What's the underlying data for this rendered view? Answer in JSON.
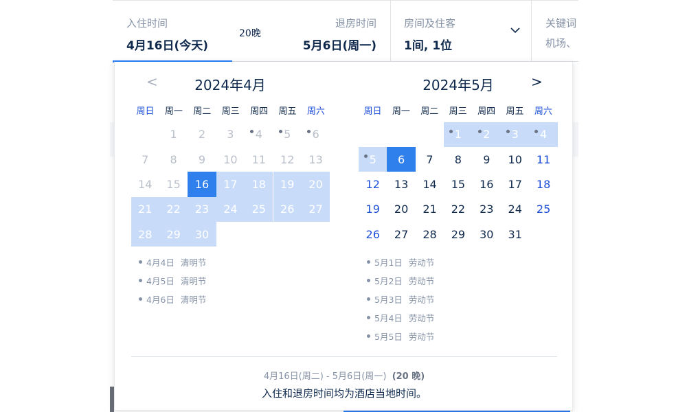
{
  "search": {
    "checkin_label": "入住时间",
    "checkin_value": "4月16日(今天)",
    "nights": "20晚",
    "checkout_label": "退房时间",
    "checkout_value": "5月6日(周一)",
    "rooms_label": "房间及住客",
    "rooms_value": "1间, 1位",
    "keyword_label": "关键词",
    "keyword_value": "机场、"
  },
  "nav": {
    "prev": "<",
    "next": ">"
  },
  "weekdays": [
    "周日",
    "周一",
    "周二",
    "周三",
    "周四",
    "周五",
    "周六"
  ],
  "april": {
    "title": "2024年4月",
    "days": [
      {
        "d": "1",
        "col": 1,
        "row": 0,
        "state": "past"
      },
      {
        "d": "2",
        "col": 2,
        "row": 0,
        "state": "past"
      },
      {
        "d": "3",
        "col": 3,
        "row": 0,
        "state": "past"
      },
      {
        "d": "4",
        "col": 4,
        "row": 0,
        "state": "past",
        "hol": true
      },
      {
        "d": "5",
        "col": 5,
        "row": 0,
        "state": "past",
        "hol": true
      },
      {
        "d": "6",
        "col": 6,
        "row": 0,
        "state": "past",
        "hol": true
      },
      {
        "d": "7",
        "col": 0,
        "row": 1,
        "state": "past"
      },
      {
        "d": "8",
        "col": 1,
        "row": 1,
        "state": "past"
      },
      {
        "d": "9",
        "col": 2,
        "row": 1,
        "state": "past"
      },
      {
        "d": "10",
        "col": 3,
        "row": 1,
        "state": "past"
      },
      {
        "d": "11",
        "col": 4,
        "row": 1,
        "state": "past"
      },
      {
        "d": "12",
        "col": 5,
        "row": 1,
        "state": "past"
      },
      {
        "d": "13",
        "col": 6,
        "row": 1,
        "state": "past"
      },
      {
        "d": "14",
        "col": 0,
        "row": 2,
        "state": "past"
      },
      {
        "d": "15",
        "col": 1,
        "row": 2,
        "state": "past"
      },
      {
        "d": "16",
        "col": 2,
        "row": 2,
        "state": "sel"
      },
      {
        "d": "17",
        "col": 3,
        "row": 2,
        "state": "inrange"
      },
      {
        "d": "18",
        "col": 4,
        "row": 2,
        "state": "inrange"
      },
      {
        "d": "19",
        "col": 5,
        "row": 2,
        "state": "inrange"
      },
      {
        "d": "20",
        "col": 6,
        "row": 2,
        "state": "inrange"
      },
      {
        "d": "21",
        "col": 0,
        "row": 3,
        "state": "inrange"
      },
      {
        "d": "22",
        "col": 1,
        "row": 3,
        "state": "inrange"
      },
      {
        "d": "23",
        "col": 2,
        "row": 3,
        "state": "inrange"
      },
      {
        "d": "24",
        "col": 3,
        "row": 3,
        "state": "inrange"
      },
      {
        "d": "25",
        "col": 4,
        "row": 3,
        "state": "inrange"
      },
      {
        "d": "26",
        "col": 5,
        "row": 3,
        "state": "inrange"
      },
      {
        "d": "27",
        "col": 6,
        "row": 3,
        "state": "inrange"
      },
      {
        "d": "28",
        "col": 0,
        "row": 4,
        "state": "inrange"
      },
      {
        "d": "29",
        "col": 1,
        "row": 4,
        "state": "inrange"
      },
      {
        "d": "30",
        "col": 2,
        "row": 4,
        "state": "inrange"
      }
    ],
    "holidays": [
      {
        "date": "4月4日",
        "name": "清明节"
      },
      {
        "date": "4月5日",
        "name": "清明节"
      },
      {
        "date": "4月6日",
        "name": "清明节"
      }
    ]
  },
  "may": {
    "title": "2024年5月",
    "days": [
      {
        "d": "1",
        "col": 3,
        "row": 0,
        "state": "inrange",
        "hol": true
      },
      {
        "d": "2",
        "col": 4,
        "row": 0,
        "state": "inrange",
        "hol": true
      },
      {
        "d": "3",
        "col": 5,
        "row": 0,
        "state": "inrange",
        "hol": true
      },
      {
        "d": "4",
        "col": 6,
        "row": 0,
        "state": "inrange",
        "hol": true
      },
      {
        "d": "5",
        "col": 0,
        "row": 1,
        "state": "inrange",
        "hol": true
      },
      {
        "d": "6",
        "col": 1,
        "row": 1,
        "state": "sel"
      },
      {
        "d": "7",
        "col": 2,
        "row": 1,
        "state": "normal"
      },
      {
        "d": "8",
        "col": 3,
        "row": 1,
        "state": "normal"
      },
      {
        "d": "9",
        "col": 4,
        "row": 1,
        "state": "normal"
      },
      {
        "d": "10",
        "col": 5,
        "row": 1,
        "state": "normal"
      },
      {
        "d": "11",
        "col": 6,
        "row": 1,
        "state": "weekend"
      },
      {
        "d": "12",
        "col": 0,
        "row": 2,
        "state": "weekend"
      },
      {
        "d": "13",
        "col": 1,
        "row": 2,
        "state": "normal"
      },
      {
        "d": "14",
        "col": 2,
        "row": 2,
        "state": "normal"
      },
      {
        "d": "15",
        "col": 3,
        "row": 2,
        "state": "normal"
      },
      {
        "d": "16",
        "col": 4,
        "row": 2,
        "state": "normal"
      },
      {
        "d": "17",
        "col": 5,
        "row": 2,
        "state": "normal"
      },
      {
        "d": "18",
        "col": 6,
        "row": 2,
        "state": "weekend"
      },
      {
        "d": "19",
        "col": 0,
        "row": 3,
        "state": "weekend"
      },
      {
        "d": "20",
        "col": 1,
        "row": 3,
        "state": "normal"
      },
      {
        "d": "21",
        "col": 2,
        "row": 3,
        "state": "normal"
      },
      {
        "d": "22",
        "col": 3,
        "row": 3,
        "state": "normal"
      },
      {
        "d": "23",
        "col": 4,
        "row": 3,
        "state": "normal"
      },
      {
        "d": "24",
        "col": 5,
        "row": 3,
        "state": "normal"
      },
      {
        "d": "25",
        "col": 6,
        "row": 3,
        "state": "weekend"
      },
      {
        "d": "26",
        "col": 0,
        "row": 4,
        "state": "weekend"
      },
      {
        "d": "27",
        "col": 1,
        "row": 4,
        "state": "normal"
      },
      {
        "d": "28",
        "col": 2,
        "row": 4,
        "state": "normal"
      },
      {
        "d": "29",
        "col": 3,
        "row": 4,
        "state": "normal"
      },
      {
        "d": "30",
        "col": 4,
        "row": 4,
        "state": "normal"
      },
      {
        "d": "31",
        "col": 5,
        "row": 4,
        "state": "normal"
      }
    ],
    "holidays": [
      {
        "date": "5月1日",
        "name": "劳动节"
      },
      {
        "date": "5月2日",
        "name": "劳动节"
      },
      {
        "date": "5月3日",
        "name": "劳动节"
      },
      {
        "date": "5月4日",
        "name": "劳动节"
      },
      {
        "date": "5月5日",
        "name": "劳动节"
      }
    ]
  },
  "footer": {
    "range": "4月16日(周二) - 5月6日(周一)",
    "nights": "(20 晚)",
    "note": "入住和退房时间均为酒店当地时间。"
  },
  "colors": {
    "selected": "#2f80ed",
    "range": "#c8dcfa",
    "weekend": "#1d4fd8",
    "past": "#b8bfc9"
  }
}
